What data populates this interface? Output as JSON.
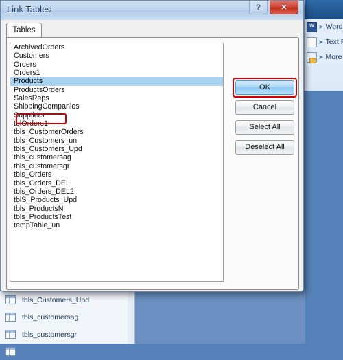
{
  "background": {
    "export_group": {
      "items": [
        {
          "label": "Word",
          "icon": "word-icon"
        },
        {
          "label": "Text File",
          "icon": "text-file-icon"
        },
        {
          "label": "More",
          "icon": "more-export-icon",
          "caret": "▾"
        }
      ],
      "arrow_glyph": "➤"
    },
    "nav_pane": {
      "items": [
        {
          "label": "tbls_Customers_Upd"
        },
        {
          "label": "tbls_customersag"
        },
        {
          "label": "tbls_customersgr"
        }
      ]
    }
  },
  "dialog": {
    "title": "Link Tables",
    "titlebar_buttons": {
      "help": "?",
      "close": "✕"
    },
    "tabs": [
      {
        "label": "Tables",
        "selected": true
      }
    ],
    "list": {
      "items": [
        "ArchivedOrders",
        "Customers",
        "Orders",
        "Orders1",
        "Products",
        "ProductsOrders",
        "SalesReps",
        "ShippingCompanies",
        "Suppliers",
        "tblOrders1",
        "tbls_CustomerOrders",
        "tbls_Customers_un",
        "tbls_Customers_Upd",
        "tbls_customersag",
        "tbls_customersgr",
        "tbls_Orders",
        "tbls_Orders_DEL",
        "tbls_Orders_DEL2",
        "tblS_Products_Upd",
        "tbls_ProductsN",
        "tbls_ProductsTest",
        "tempTable_un"
      ],
      "selected_index": 4,
      "selected_value": "Products"
    },
    "buttons": {
      "ok": "OK",
      "cancel": "Cancel",
      "select_all": "Select All",
      "deselect_all": "Deselect All"
    },
    "annotations": {
      "highlight_color": "#cc0000",
      "highlighted_items": [
        "Products",
        "OK"
      ]
    }
  }
}
